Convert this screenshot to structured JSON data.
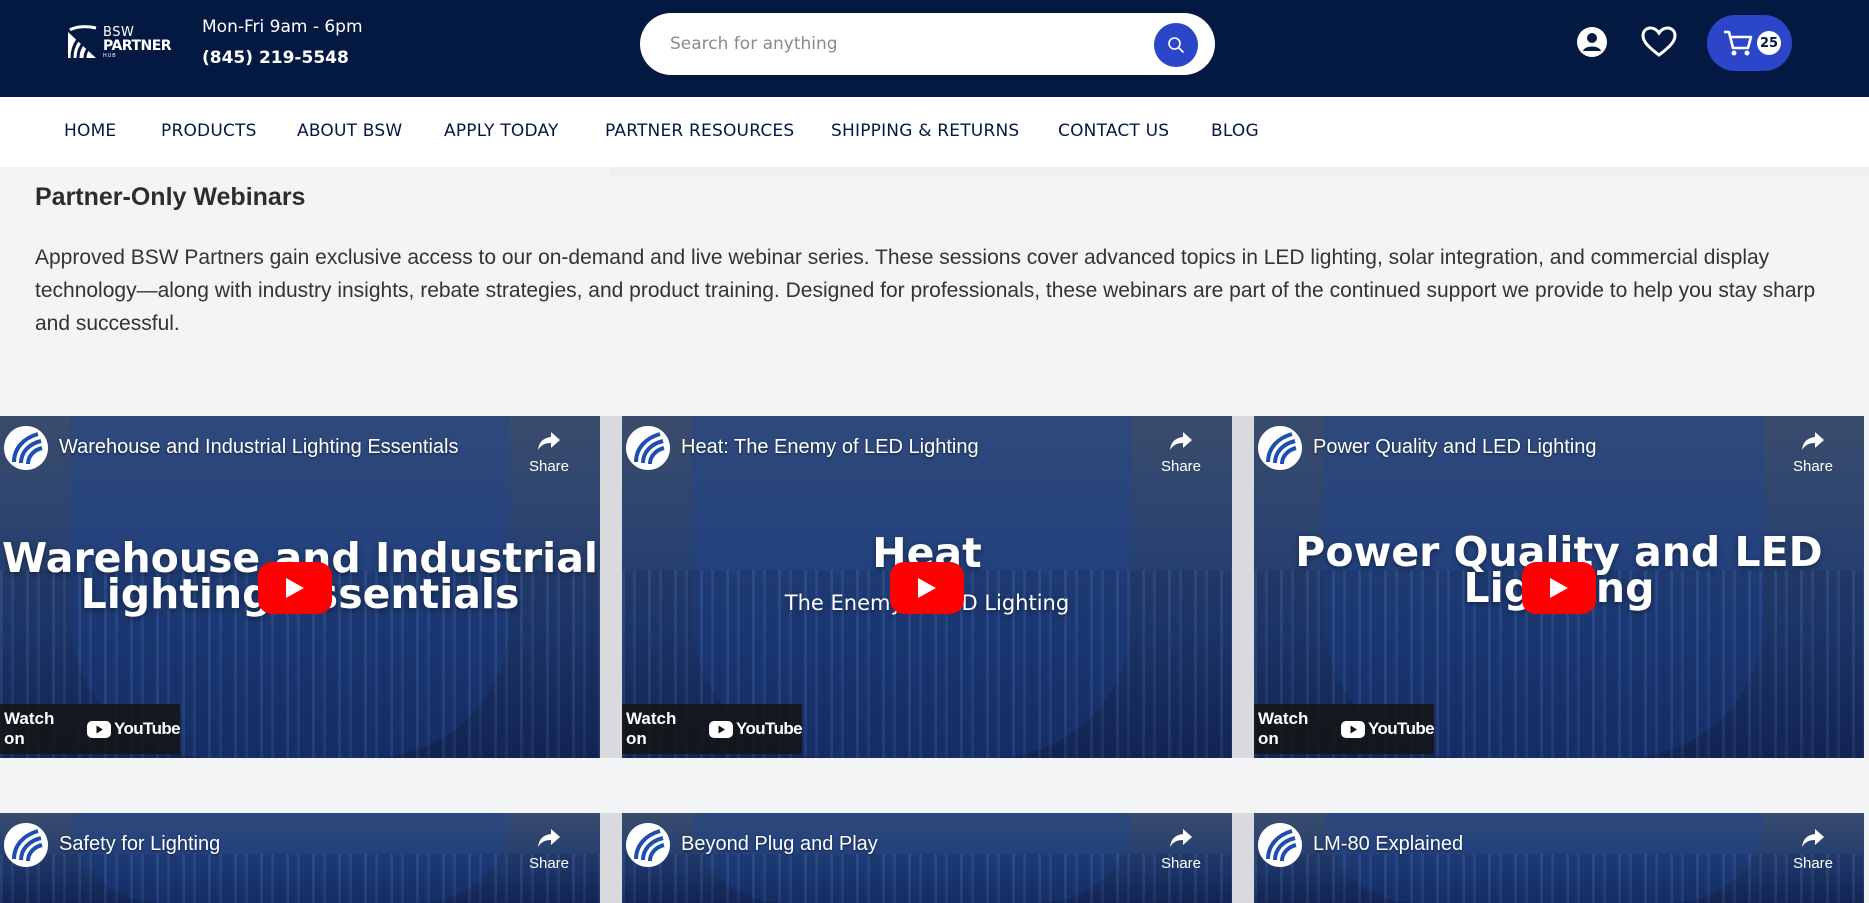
{
  "header": {
    "logo": {
      "line1": "BSW",
      "line2": "PARTNER",
      "line3": "HUB"
    },
    "hours": "Mon-Fri 9am - 6pm",
    "phone": "(845) 219-5548",
    "search": {
      "placeholder": "Search for anything",
      "value": ""
    },
    "cart": {
      "count": "25"
    },
    "icons": {
      "account": "account-icon",
      "wishlist": "heart-icon",
      "cart": "cart-icon",
      "search": "search-icon"
    }
  },
  "nav": {
    "items": [
      {
        "label": "HOME"
      },
      {
        "label": "PRODUCTS"
      },
      {
        "label": "ABOUT BSW"
      },
      {
        "label": "APPLY TODAY"
      },
      {
        "label": "PARTNER RESOURCES"
      },
      {
        "label": "SHIPPING & RETURNS"
      },
      {
        "label": "CONTACT US"
      },
      {
        "label": "BLOG"
      }
    ]
  },
  "main": {
    "title": "Partner-Only Webinars",
    "description": "Approved BSW Partners gain exclusive access to our on-demand and live webinar series. These sessions cover advanced topics in LED lighting, solar integration, and commercial display technology—along with industry insights, rebate strategies, and product training. Designed for professionals, these webinars are part of the continued support we provide to help you stay sharp and successful."
  },
  "videos": [
    {
      "title": "Warehouse and Industrial Lighting Essentials",
      "headline1": "Warehouse and Industrial",
      "headline2": "Lighting Essentials",
      "sub": "",
      "share": "Share",
      "watch_on": "Watch on",
      "youtube": "YouTube"
    },
    {
      "title": "Heat: The Enemy of LED Lighting",
      "headline1": "Heat",
      "headline2": "",
      "sub": "The Enemy of LED Lighting",
      "share": "Share",
      "watch_on": "Watch on",
      "youtube": "YouTube"
    },
    {
      "title": "Power Quality and LED Lighting",
      "headline1": "Power Quality and LED",
      "headline2": "Lighting",
      "sub": "",
      "share": "Share",
      "watch_on": "Watch on",
      "youtube": "YouTube"
    },
    {
      "title": "Safety for Lighting",
      "share": "Share"
    },
    {
      "title": "Beyond Plug and Play",
      "share": "Share"
    },
    {
      "title": "LM-80 Explained",
      "share": "Share"
    }
  ],
  "colors": {
    "header_bg": "#031942",
    "accent": "#2b46c8",
    "youtube_red": "#ff0000"
  }
}
